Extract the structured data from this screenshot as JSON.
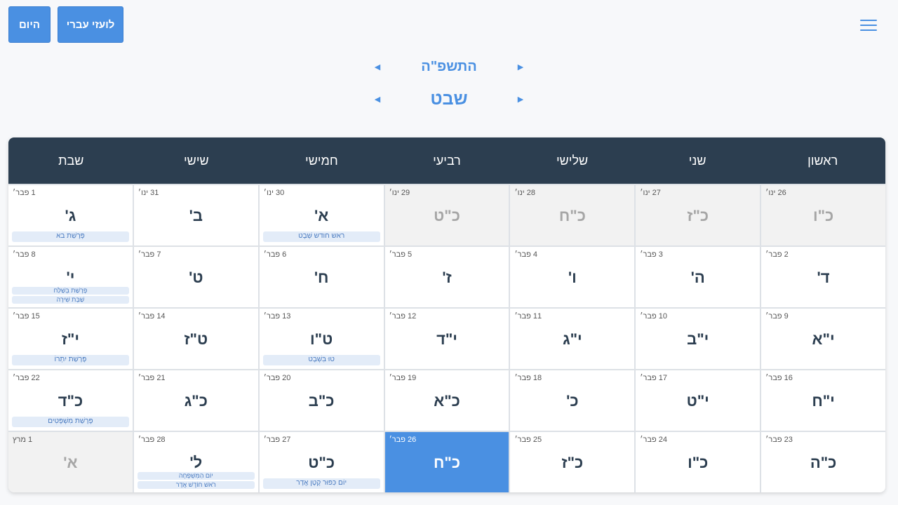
{
  "header": {
    "menu_icon": "hamburger-menu-icon",
    "toggle_label": "לועזי עברי",
    "today_label": "היום",
    "year": "התשפ\"ה",
    "month": "שבט",
    "prev_arrow": "◀",
    "next_arrow": "▶"
  },
  "colors": {
    "accent": "#4a90e2",
    "header_bg": "#2c3e50",
    "today_bg": "#4a90e2"
  },
  "weekdays": [
    "ראשון",
    "שני",
    "שלישי",
    "רביעי",
    "חמישי",
    "שישי",
    "שבת"
  ],
  "cells": [
    {
      "heb": "כ\"ו",
      "greg": "26 ינו׳",
      "other": true,
      "events": []
    },
    {
      "heb": "כ\"ז",
      "greg": "27 ינו׳",
      "other": true,
      "events": []
    },
    {
      "heb": "כ\"ח",
      "greg": "28 ינו׳",
      "other": true,
      "events": []
    },
    {
      "heb": "כ\"ט",
      "greg": "29 ינו׳",
      "other": true,
      "events": []
    },
    {
      "heb": "א'",
      "greg": "30 ינו׳",
      "events": [
        "ראש חודש שְׁבָט"
      ]
    },
    {
      "heb": "ב'",
      "greg": "31 ינו׳",
      "events": []
    },
    {
      "heb": "ג'",
      "greg": "1 פבר׳",
      "events": [
        "פָּרָשַׁת בא"
      ]
    },
    {
      "heb": "ד'",
      "greg": "2 פבר׳",
      "events": []
    },
    {
      "heb": "ה'",
      "greg": "3 פבר׳",
      "events": []
    },
    {
      "heb": "ו'",
      "greg": "4 פבר׳",
      "events": []
    },
    {
      "heb": "ז'",
      "greg": "5 פבר׳",
      "events": []
    },
    {
      "heb": "ח'",
      "greg": "6 פבר׳",
      "events": []
    },
    {
      "heb": "ט'",
      "greg": "7 פבר׳",
      "events": []
    },
    {
      "heb": "י'",
      "greg": "8 פבר׳",
      "events": [
        "פָּרָשַׁת בְּשַׁלַּח",
        "שַׁבָּת שִׁירָה"
      ]
    },
    {
      "heb": "י\"א",
      "greg": "9 פבר׳",
      "events": []
    },
    {
      "heb": "י\"ב",
      "greg": "10 פבר׳",
      "events": []
    },
    {
      "heb": "י\"ג",
      "greg": "11 פבר׳",
      "events": []
    },
    {
      "heb": "י\"ד",
      "greg": "12 פבר׳",
      "events": []
    },
    {
      "heb": "ט\"ו",
      "greg": "13 פבר׳",
      "events": [
        "טוּ בִּשְׁבָט"
      ]
    },
    {
      "heb": "ט\"ז",
      "greg": "14 פבר׳",
      "events": []
    },
    {
      "heb": "י\"ז",
      "greg": "15 פבר׳",
      "events": [
        "פָּרָשַׁת יִתְרוֹ"
      ]
    },
    {
      "heb": "י\"ח",
      "greg": "16 פבר׳",
      "events": []
    },
    {
      "heb": "י\"ט",
      "greg": "17 פבר׳",
      "events": []
    },
    {
      "heb": "כ'",
      "greg": "18 פבר׳",
      "events": []
    },
    {
      "heb": "כ\"א",
      "greg": "19 פבר׳",
      "events": []
    },
    {
      "heb": "כ\"ב",
      "greg": "20 פבר׳",
      "events": []
    },
    {
      "heb": "כ\"ג",
      "greg": "21 פבר׳",
      "events": []
    },
    {
      "heb": "כ\"ד",
      "greg": "22 פבר׳",
      "events": [
        "פָּרָשַׁת מִשְׁפָּטִים"
      ]
    },
    {
      "heb": "כ\"ה",
      "greg": "23 פבר׳",
      "events": []
    },
    {
      "heb": "כ\"ו",
      "greg": "24 פבר׳",
      "events": []
    },
    {
      "heb": "כ\"ז",
      "greg": "25 פבר׳",
      "events": []
    },
    {
      "heb": "כ\"ח",
      "greg": "26 פבר׳",
      "today": true,
      "events": []
    },
    {
      "heb": "כ\"ט",
      "greg": "27 פבר׳",
      "events": [
        "יוֹם כִּפּוּר קָטָן אֲדָר"
      ]
    },
    {
      "heb": "ל'",
      "greg": "28 פבר׳",
      "events": [
        "יוֹם הַמִּשְׁפָּחָה",
        "רֹאשׁ חוֹדֶשׁ אֲדָר"
      ]
    },
    {
      "heb": "א'",
      "greg": "1 מרץ",
      "other": true,
      "events": []
    }
  ]
}
